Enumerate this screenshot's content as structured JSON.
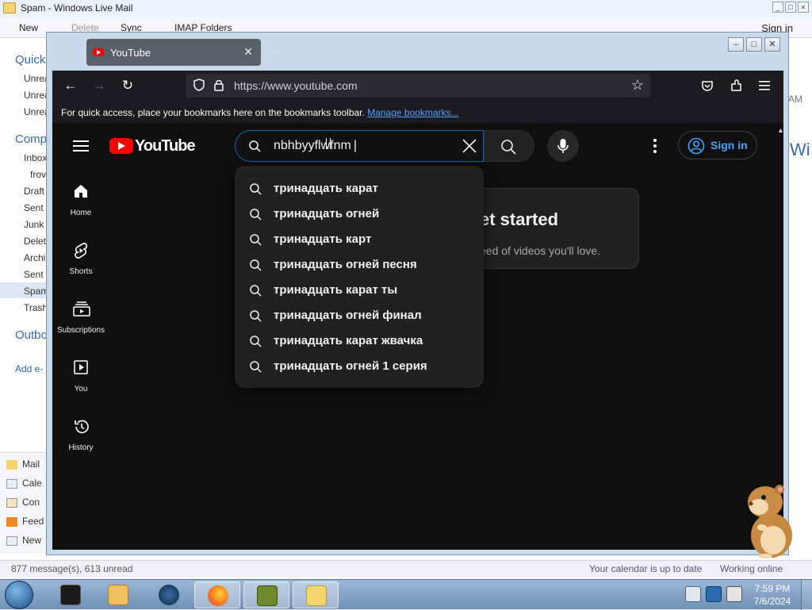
{
  "wlm": {
    "title": "Spam - Windows Live Mail",
    "toolbar": {
      "new": "New",
      "delete": "Delete",
      "sync": "Sync",
      "imap": "IMAP Folders"
    },
    "signin": "Sign in",
    "quick_views": "Quick",
    "unread1": "Unrea",
    "unread2": "Unrea",
    "unread3": "Unrea",
    "computer": "Comp",
    "inbox": "Inbox",
    "from": "frov",
    "drafts": "Draft",
    "sent": "Sent",
    "junk": "Junk",
    "deleted": "Delet",
    "archive": "Archi",
    "sent2": "Sent",
    "spam": "Spam",
    "trash": "Trash",
    "outbox": "Outbo",
    "add_account": "Add e-",
    "nav": {
      "mail": "Mail",
      "calendar": "Cale",
      "contacts": "Con",
      "feeds": "Feed",
      "newsgroups": "New"
    },
    "right_am": "AM",
    "right_wi": "Wi",
    "status_left": "877 message(s), 613 unread",
    "status_calendar": "Your calendar is up to date",
    "status_online": "Working online"
  },
  "firefox": {
    "tab_title": "YouTube",
    "url": "https://www.youtube.com",
    "bookmarks_text": "For quick access, place your bookmarks here on the bookmarks toolbar.",
    "bookmarks_link": "Manage bookmarks..."
  },
  "youtube": {
    "logo": "YouTube",
    "search_query": "nbhbyyflwfnm",
    "signin": "Sign in",
    "sidebar": [
      "Home",
      "Shorts",
      "Subscriptions",
      "You",
      "History"
    ],
    "card_heading": "et started",
    "card_sub": "eed of videos you'll love.",
    "suggestions": [
      "тринадцать карат",
      "тринадцать огней",
      "тринадцать карт",
      "тринадцать огней песня",
      "тринадцать карат ты",
      "тринадцать огней финал",
      "тринадцать карат жвачка",
      "тринадцать огней 1 серия"
    ]
  },
  "taskbar": {
    "time": "7:59 PM",
    "date": "7/6/2024",
    "colors": {
      "firefox": "#ff7a1a",
      "box": "#6f8a2e"
    }
  }
}
